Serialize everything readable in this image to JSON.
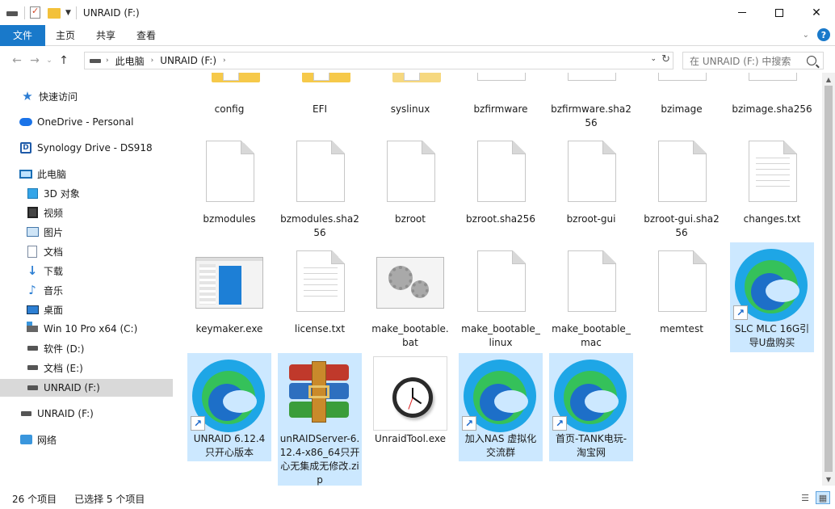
{
  "window": {
    "title": "UNRAID (F:)"
  },
  "ribbon": {
    "tabs": [
      "文件",
      "主页",
      "共享",
      "查看"
    ]
  },
  "address": {
    "crumbs": [
      "此电脑",
      "UNRAID (F:)"
    ],
    "search_placeholder": "在 UNRAID (F:) 中搜索"
  },
  "sidebar": {
    "items": [
      {
        "label": "快速访问",
        "icon": "star-icon"
      },
      {
        "label": "OneDrive - Personal",
        "icon": "cloud-icon"
      },
      {
        "label": "Synology Drive - DS918",
        "icon": "synology-icon"
      },
      {
        "label": "此电脑",
        "icon": "computer-icon"
      },
      {
        "label": "3D 对象",
        "icon": "cube-icon"
      },
      {
        "label": "视频",
        "icon": "film-icon"
      },
      {
        "label": "图片",
        "icon": "picture-icon"
      },
      {
        "label": "文档",
        "icon": "document-icon"
      },
      {
        "label": "下载",
        "icon": "download-icon"
      },
      {
        "label": "音乐",
        "icon": "music-icon"
      },
      {
        "label": "桌面",
        "icon": "desktop-icon"
      },
      {
        "label": "Win 10 Pro x64 (C:)",
        "icon": "windows-drive-icon"
      },
      {
        "label": "软件 (D:)",
        "icon": "drive-icon"
      },
      {
        "label": "文档 (E:)",
        "icon": "drive-icon"
      },
      {
        "label": "UNRAID (F:)",
        "icon": "drive-icon",
        "selected": true
      },
      {
        "label": "UNRAID (F:)",
        "icon": "drive-icon"
      },
      {
        "label": "网络",
        "icon": "network-icon"
      }
    ]
  },
  "files": {
    "row1": [
      {
        "name": "config",
        "type": "folder"
      },
      {
        "name": "EFI",
        "type": "folder"
      },
      {
        "name": "syslinux",
        "type": "folder"
      },
      {
        "name": "bzfirmware",
        "type": "file"
      },
      {
        "name": "bzfirmware.sha256",
        "type": "file"
      },
      {
        "name": "bzimage",
        "type": "file"
      },
      {
        "name": "bzimage.sha256",
        "type": "file"
      }
    ],
    "row2": [
      {
        "name": "bzmodules",
        "type": "file"
      },
      {
        "name": "bzmodules.sha256",
        "type": "file"
      },
      {
        "name": "bzroot",
        "type": "file"
      },
      {
        "name": "bzroot.sha256",
        "type": "file"
      },
      {
        "name": "bzroot-gui",
        "type": "file"
      },
      {
        "name": "bzroot-gui.sha256",
        "type": "file"
      },
      {
        "name": "changes.txt",
        "type": "text"
      }
    ],
    "row3": [
      {
        "name": "keymaker.exe",
        "type": "app"
      },
      {
        "name": "license.txt",
        "type": "text"
      },
      {
        "name": "make_bootable.bat",
        "type": "batch"
      },
      {
        "name": "make_bootable_linux",
        "type": "file"
      },
      {
        "name": "make_bootable_mac",
        "type": "file"
      },
      {
        "name": "memtest",
        "type": "file"
      },
      {
        "name": "SLC MLC 16G引导U盘购买",
        "type": "edge-link",
        "selected": true
      }
    ],
    "row4": [
      {
        "name": "UNRAID 6.12.4只开心版本",
        "type": "edge-link",
        "selected": true
      },
      {
        "name": "unRAIDServer-6.12.4-x86_64只开心无集成无修改.zip",
        "type": "rar",
        "selected": true
      },
      {
        "name": "UnraidTool.exe",
        "type": "clock"
      },
      {
        "name": "加入NAS 虚拟化交流群",
        "type": "edge-link",
        "selected": true
      },
      {
        "name": "首页-TANK电玩-淘宝网",
        "type": "edge-link",
        "selected": true
      }
    ]
  },
  "status": {
    "count": "26 个项目",
    "selected": "已选择 5 个项目"
  },
  "colors": {
    "accent": "#1979ca",
    "selection": "#cce8ff"
  }
}
